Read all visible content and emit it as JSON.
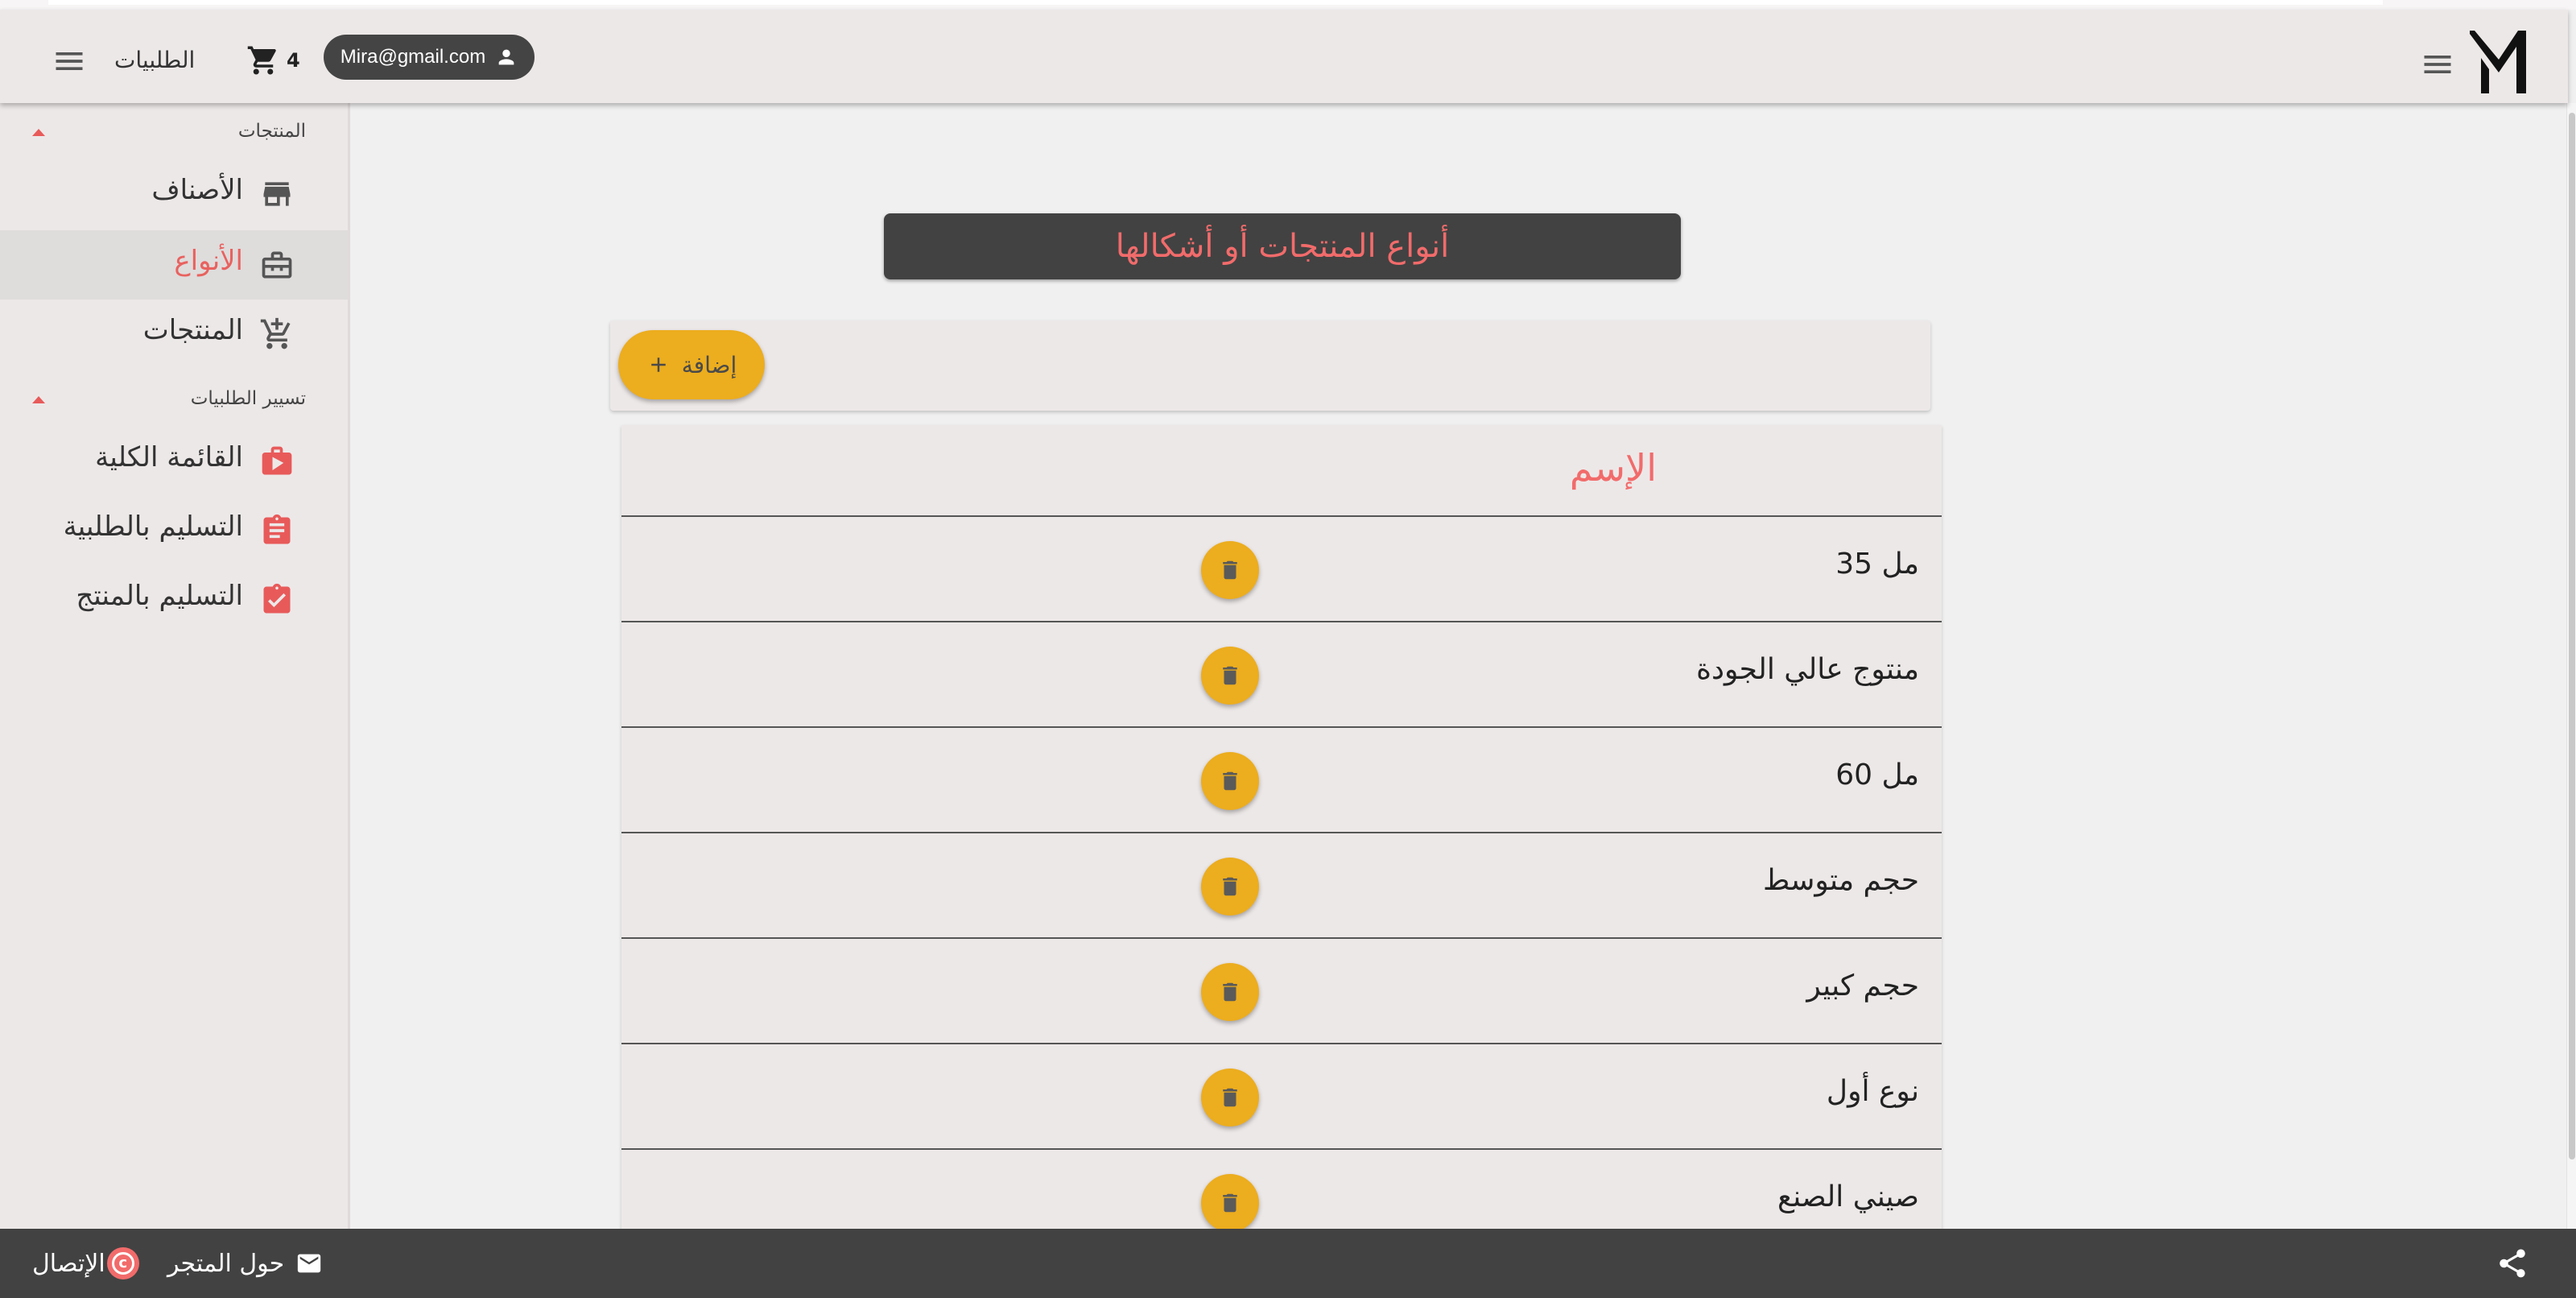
{
  "header": {
    "orders_label": "الطلبيات",
    "cart_count": "4",
    "user_email": "Mira@gmail.com"
  },
  "sidebar": {
    "sections": [
      {
        "title": "المنتجات",
        "items": [
          {
            "label": "الأصناف",
            "icon": "store-icon",
            "active": false
          },
          {
            "label": "الأنواع",
            "icon": "briefcase-icon",
            "active": true
          },
          {
            "label": "المنتجات",
            "icon": "cart-add-icon",
            "active": false
          }
        ]
      },
      {
        "title": "تسيير الطلبيات",
        "items": [
          {
            "label": "القائمة الكلية",
            "icon": "play-bag-icon",
            "active": false
          },
          {
            "label": "التسليم بالطلبية",
            "icon": "clipboard-icon",
            "active": false
          },
          {
            "label": "التسليم بالمنتج",
            "icon": "clipboard-check-icon",
            "active": false
          }
        ]
      }
    ]
  },
  "main": {
    "title": "أنواع المنتجات أو أشكالها",
    "add_label": "إضافة",
    "table": {
      "column_name": "الإسم",
      "rows": [
        "35 مل",
        "منتوج عالي الجودة",
        "60 مل",
        "حجم متوسط",
        "حجم كبير",
        "نوع أول",
        "صيني الصنع"
      ]
    }
  },
  "footer": {
    "about_label": "حول المتجر",
    "contact_label": "الإتصال"
  },
  "colors": {
    "accent": "#f26b6b",
    "button": "#ecad1e",
    "dark": "#424242"
  }
}
